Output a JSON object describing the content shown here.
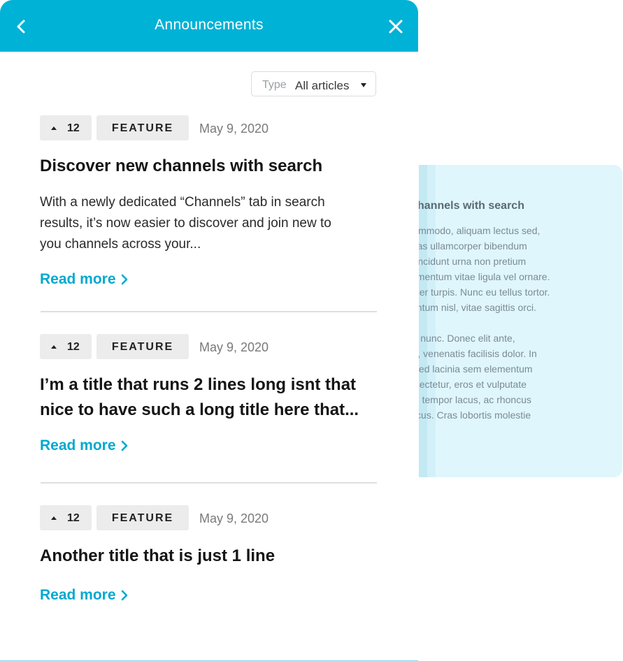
{
  "header": {
    "title": "Announcements",
    "back_icon": "chevron-left-icon",
    "close_icon": "close-icon"
  },
  "filter": {
    "label": "Type",
    "value": "All articles"
  },
  "articles": [
    {
      "votes": "12",
      "tag": "FEATURE",
      "date": "May 9, 2020",
      "title": "Discover new channels with search",
      "excerpt": "With a newly dedicated “Channels” tab in search\nresults, it’s now easier to discover and join new to\nyou channels across your...",
      "read_more": "Read more"
    },
    {
      "votes": "12",
      "tag": "FEATURE",
      "date": "May 9, 2020",
      "title_line1": "I’m a title that runs 2 lines long isnt that",
      "title_line2": "nice to have such a long title here that...",
      "read_more": "Read more"
    },
    {
      "votes": "12",
      "tag": "FEATURE",
      "date": "May 9, 2020",
      "title": "Another title that is just 1 line",
      "read_more": "Read more"
    }
  ],
  "preview": {
    "title": "er new channels with search",
    "para1": "s nulla commodo, aliquam lectus sed,\n ugue. Cras ullamcorper bibendum\nm. Duis tincidunt urna non pretium\nam condimentum vitae ligula vel ornare.\ns at semper turpis. Nunc eu tellus tortor.\n condimentum nisl, vitae sagittis orci.",
    "para2": "dignissim nunc. Donec elit ante,\na dolor et, venenatis facilisis dolor. In\nrci odio, sed lacinia sem elementum\nuam consectetur, eros et vulputate\n. nunc leo tempor lacus, ac rhoncus\nos nec lacus. Cras lobortis molestie"
  },
  "colors": {
    "accent": "#00b2d6",
    "link": "#00a9d0",
    "preview_bg": "#dff6fc"
  }
}
